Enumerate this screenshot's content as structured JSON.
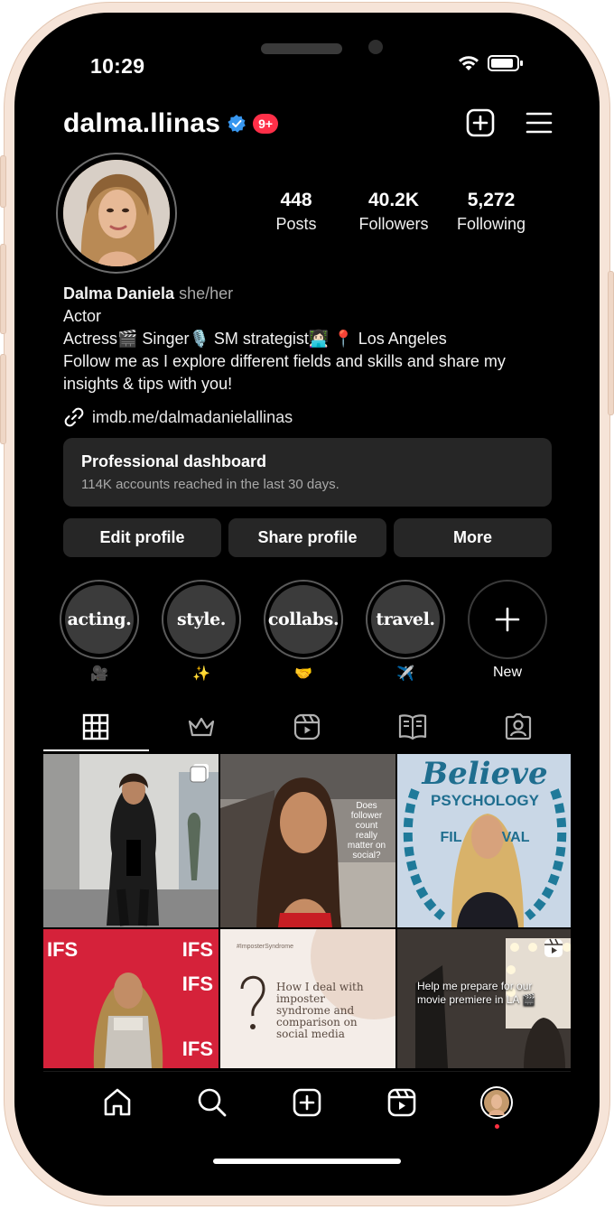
{
  "status_bar": {
    "time": "10:29"
  },
  "header": {
    "username": "dalma.llinas",
    "notification_badge": "9+"
  },
  "stats": [
    {
      "value": "448",
      "label": "Posts"
    },
    {
      "value": "40.2K",
      "label": "Followers"
    },
    {
      "value": "5,272",
      "label": "Following"
    }
  ],
  "bio": {
    "name": "Dalma Daniela",
    "pronouns": "she/her",
    "category": "Actor",
    "line1": "Actress🎬 Singer🎙️ SM strategist👩🏻‍💻 📍 Los Angeles",
    "line2": "Follow me as I explore different fields and skills and share my insights & tips with you!",
    "link": "imdb.me/dalmadanielallinas"
  },
  "dashboard": {
    "title": "Professional dashboard",
    "subtitle": "114K accounts reached in the last 30 days."
  },
  "actions": {
    "edit": "Edit profile",
    "share": "Share profile",
    "more": "More"
  },
  "highlights": [
    {
      "cover": "acting.",
      "label": "🎥"
    },
    {
      "cover": "style.",
      "label": "✨"
    },
    {
      "cover": "collabs.",
      "label": "🤝"
    },
    {
      "cover": "travel.",
      "label": "✈️"
    },
    {
      "cover": "+",
      "label": "New"
    }
  ],
  "posts": {
    "p2_text": "Does follower count really matter on social?",
    "p3_title": "Believe",
    "p3_sub1": "PSYCHOLOGY",
    "p3_sub2": "FIL          VAL",
    "p4_text": "IFS",
    "p5_tag": "#ImposterSyndrome",
    "p5_text": "How I deal with imposter syndrome and comparison on social media",
    "p6_text": "Help me prepare for our movie premiere in LA 🎬"
  },
  "colors": {
    "accent_badge": "#ff2f48",
    "verified": "#3897f0",
    "background": "#000000",
    "surface": "#262626"
  }
}
